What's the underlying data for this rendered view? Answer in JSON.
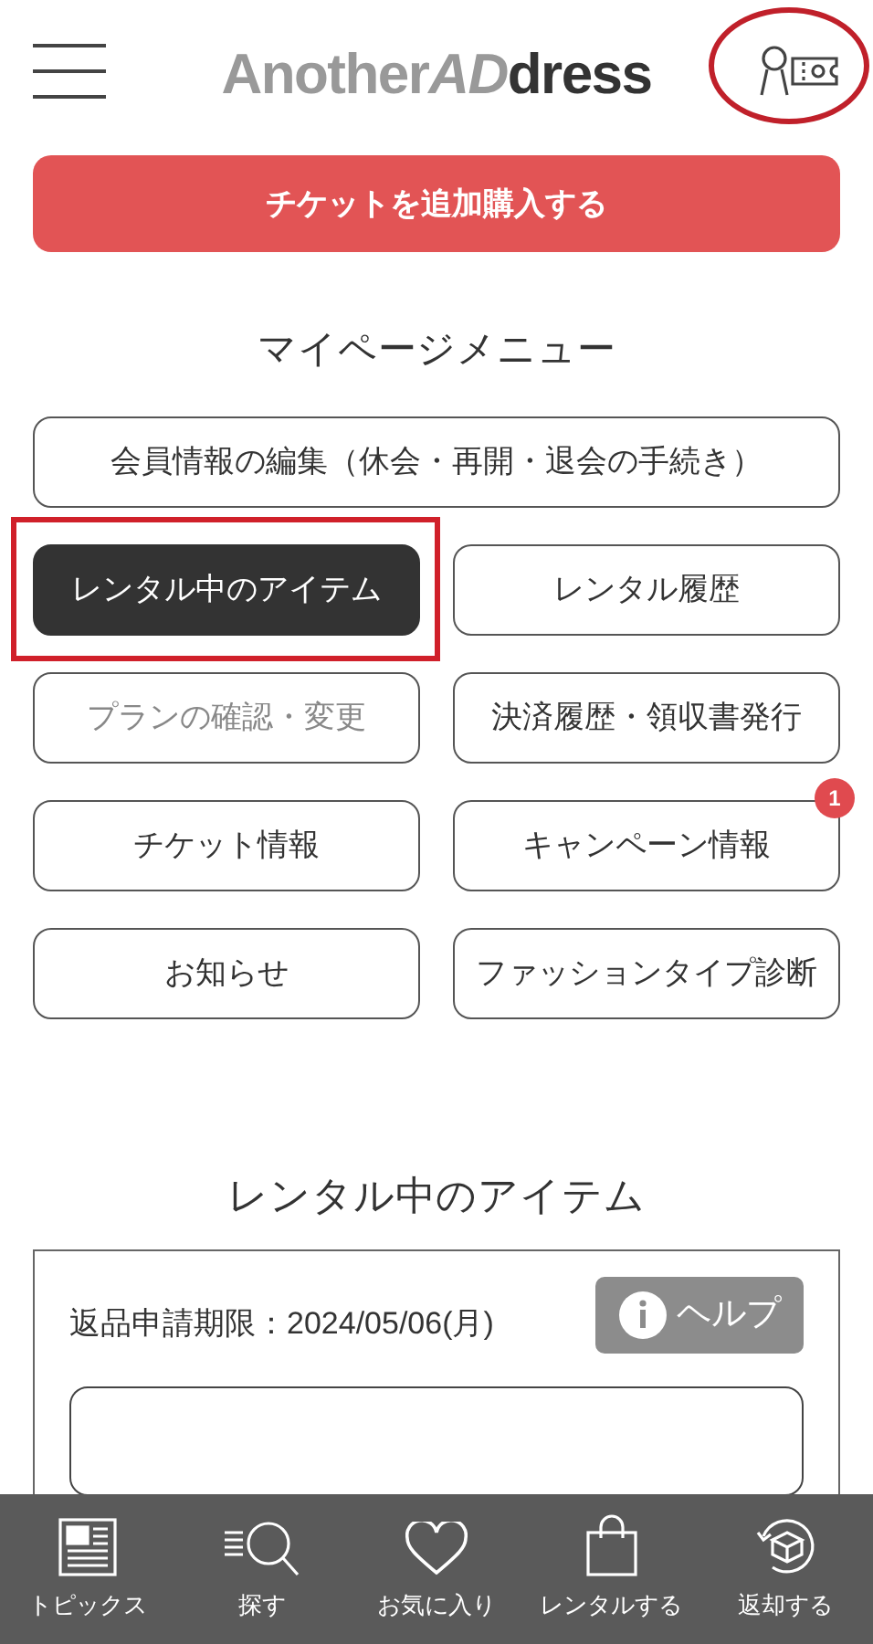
{
  "header": {
    "logo": [
      {
        "text": "Another",
        "kind": "light"
      },
      {
        "text": "AD",
        "kind": "italic"
      },
      {
        "text": "dress",
        "kind": "dark"
      }
    ],
    "ticket_icon_circled": true
  },
  "buy_button": "チケットを追加購入する",
  "menu_title": "マイページメニュー",
  "menu": [
    {
      "label": "会員情報の編集（休会・再開・退会の手続き）",
      "kind": "wide",
      "selected": false,
      "disabled": false,
      "highlighted": false
    },
    {
      "label": "レンタル中のアイテム",
      "kind": "half",
      "selected": true,
      "disabled": false,
      "highlighted": true
    },
    {
      "label": "レンタル履歴",
      "kind": "half",
      "selected": false,
      "disabled": false,
      "highlighted": false
    },
    {
      "label": "プランの確認・変更",
      "kind": "half",
      "selected": false,
      "disabled": true,
      "highlighted": false
    },
    {
      "label": "決済履歴・領収書発行",
      "kind": "half",
      "selected": false,
      "disabled": false,
      "highlighted": false
    },
    {
      "label": "チケット情報",
      "kind": "half",
      "selected": false,
      "disabled": false,
      "highlighted": false
    },
    {
      "label": "キャンペーン情報",
      "kind": "half",
      "selected": false,
      "disabled": false,
      "highlighted": false,
      "badge": "1"
    },
    {
      "label": "お知らせ",
      "kind": "half",
      "selected": false,
      "disabled": false,
      "highlighted": false
    },
    {
      "label": "ファッションタイプ診断",
      "kind": "half",
      "selected": false,
      "disabled": false,
      "highlighted": false
    }
  ],
  "rental_title": "レンタル中のアイテム",
  "rental_card": {
    "deadline": "返品申請期限：2024/05/06(月)",
    "help_button": "ヘルプ"
  },
  "bottom_nav": [
    {
      "label": "トピックス",
      "kind": "news"
    },
    {
      "label": "探す",
      "kind": "search"
    },
    {
      "label": "お気に入り",
      "kind": "heart"
    },
    {
      "label": "レンタルする",
      "kind": "bag"
    },
    {
      "label": "返却する",
      "kind": "return"
    }
  ]
}
